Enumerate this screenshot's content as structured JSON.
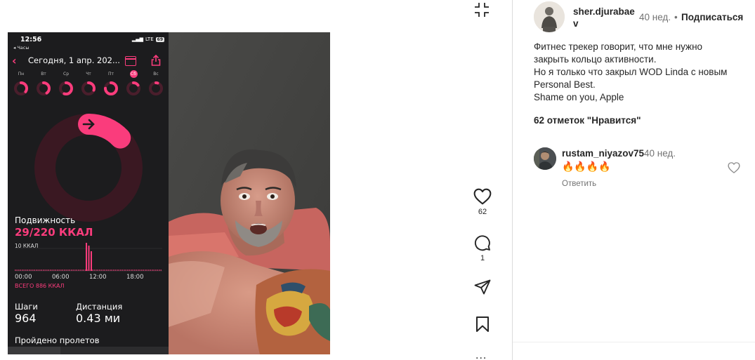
{
  "post": {
    "author": {
      "username": "sher.djurabaev",
      "time": "40 нед.",
      "dot": "•",
      "follow_label": "Подписаться"
    },
    "caption_lines": [
      "Фитнес трекер говорит, что мне нужно",
      "закрыть кольцо активности.",
      "Но я только что закрыл WOD Linda с новым",
      "Personal Best.",
      "Shame on you, Apple"
    ],
    "likes_text": "62 отметок \"Нравится\"",
    "comment": {
      "username": "rustam_niyazov75",
      "time": "40 нед.",
      "text": "🔥🔥🔥🔥",
      "reply_label": "Ответить"
    },
    "actions": {
      "like_count": "62",
      "comment_count": "1",
      "more": "..."
    },
    "icons": [
      "collapse-icon",
      "heart-icon",
      "comment-icon",
      "share-icon",
      "bookmark-icon",
      "more-icon"
    ],
    "colors": {
      "accent": "#fa3c7c",
      "text": "#262626",
      "muted": "#737373"
    }
  },
  "phone": {
    "time": "12:56",
    "back_label": "◂ Часы",
    "network": "LTE",
    "battery": "69",
    "header_title": "Сегодня, 1 апр. 202...",
    "days": [
      "Пн",
      "Вт",
      "Ср",
      "Чт",
      "Пт",
      "Сб",
      "Вс"
    ],
    "selected_day": "Сб",
    "day_progress": [
      0.35,
      0.4,
      0.55,
      0.3,
      0.75,
      0.15,
      0.05
    ],
    "ring_progress": 0.13,
    "move_label": "Подвижность",
    "move_value": "29/220 ККАЛ",
    "chart_max_label": "10 ККАЛ",
    "axis_labels": [
      "00:00",
      "06:00",
      "12:00",
      "18:00"
    ],
    "total_label": "ВСЕГО 886 ККАЛ",
    "steps_label": "Шаги",
    "steps_value": "964",
    "distance_label": "Дистанция",
    "distance_value": "0.43 ми",
    "floors_label": "Пройдено пролетов"
  }
}
